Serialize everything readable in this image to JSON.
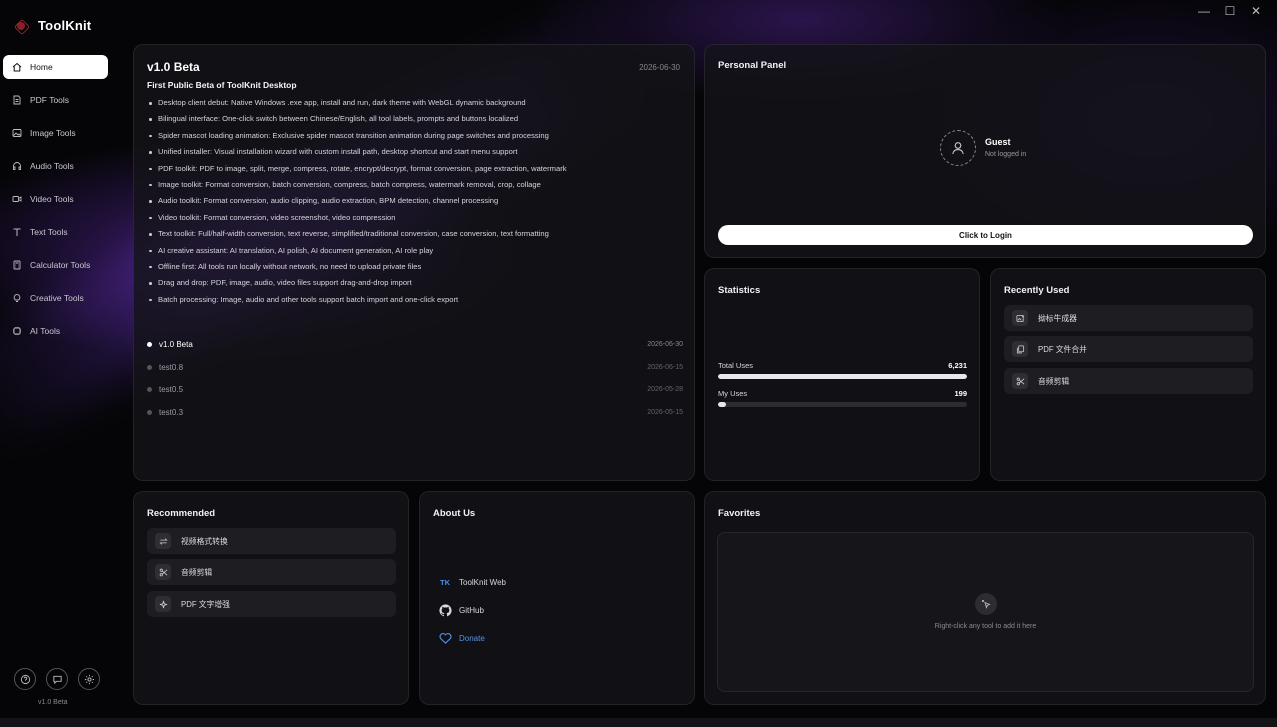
{
  "app": {
    "name": "ToolKnit",
    "version": "v1.0 Beta"
  },
  "window_controls": {
    "minimize": "—",
    "maximize": "☐",
    "close": "✕"
  },
  "sidebar": {
    "items": [
      {
        "label": "Home",
        "icon": "home-icon",
        "active": true
      },
      {
        "label": "PDF Tools",
        "icon": "document-icon"
      },
      {
        "label": "Image Tools",
        "icon": "image-icon"
      },
      {
        "label": "Audio Tools",
        "icon": "headphones-icon"
      },
      {
        "label": "Video Tools",
        "icon": "video-icon"
      },
      {
        "label": "Text Tools",
        "icon": "text-icon"
      },
      {
        "label": "Calculator Tools",
        "icon": "calculator-icon"
      },
      {
        "label": "Creative Tools",
        "icon": "lightbulb-icon"
      },
      {
        "label": "AI Tools",
        "icon": "ai-icon"
      }
    ],
    "bottom_buttons": [
      "help-icon",
      "feedback-icon",
      "settings-icon"
    ]
  },
  "changelog": {
    "title": "v1.0 Beta",
    "date": "2026-06-30",
    "subtitle": "First Public Beta of ToolKnit Desktop",
    "notes": [
      "Desktop client debut: Native Windows .exe app, install and run, dark theme with WebGL dynamic background",
      "Bilingual interface: One-click switch between Chinese/English, all tool labels, prompts and buttons localized",
      "Spider mascot loading animation: Exclusive spider mascot transition animation during page switches and processing",
      "Unified installer: Visual installation wizard with custom install path, desktop shortcut and start menu support",
      "PDF toolkit: PDF to image, split, merge, compress, rotate, encrypt/decrypt, format conversion, page extraction, watermark",
      "Image toolkit: Format conversion, batch conversion, compress, batch compress, watermark removal, crop, collage",
      "Audio toolkit: Format conversion, audio clipping, audio extraction, BPM detection, channel processing",
      "Video toolkit: Format conversion, video screenshot, video compression",
      "Text toolkit: Full/half-width conversion, text reverse, simplified/traditional conversion, case conversion, text formatting",
      "AI creative assistant: AI translation, AI polish, AI document generation, AI role play",
      "Offline first: All tools run locally without network, no need to upload private files",
      "Drag and drop: PDF, image, audio, video files support drag-and-drop import",
      "Batch processing: Image, audio and other tools support batch import and one-click export"
    ],
    "versions": [
      {
        "name": "v1.0 Beta",
        "date": "2026-06-30",
        "current": true
      },
      {
        "name": "test0.8",
        "date": "2026-06-15"
      },
      {
        "name": "test0.5",
        "date": "2026-05-28"
      },
      {
        "name": "test0.3",
        "date": "2026-05-15"
      }
    ]
  },
  "personal": {
    "title": "Personal Panel",
    "name": "Guest",
    "status": "Not logged in",
    "login_label": "Click to Login"
  },
  "statistics": {
    "title": "Statistics",
    "total_label": "Total Uses",
    "total_value": "6,231",
    "total_fraction": 1.0,
    "my_label": "My Uses",
    "my_value": "199",
    "my_fraction": 0.032
  },
  "recent": {
    "title": "Recently Used",
    "items": [
      {
        "label": "拗标牛成器",
        "icon": "image-add-icon"
      },
      {
        "label": "PDF 文件合并",
        "icon": "copy-icon"
      },
      {
        "label": "音频剪辑",
        "icon": "scissors-icon"
      }
    ]
  },
  "recommended": {
    "title": "Recommended",
    "items": [
      {
        "label": "视频格式转换",
        "icon": "swap-icon"
      },
      {
        "label": "音频剪辑",
        "icon": "scissors-icon"
      },
      {
        "label": "PDF 文字增强",
        "icon": "sparkle-icon"
      }
    ]
  },
  "about": {
    "title": "About Us",
    "web_badge": "TK",
    "web_label": "ToolKnit Web",
    "github_label": "GitHub",
    "donate_label": "Donate"
  },
  "favorites": {
    "title": "Favorites",
    "hint": "Right-click any tool to add it here"
  },
  "colors": {
    "accent_blue": "#4f8ee8",
    "purple_glow": "#6e37d2"
  }
}
